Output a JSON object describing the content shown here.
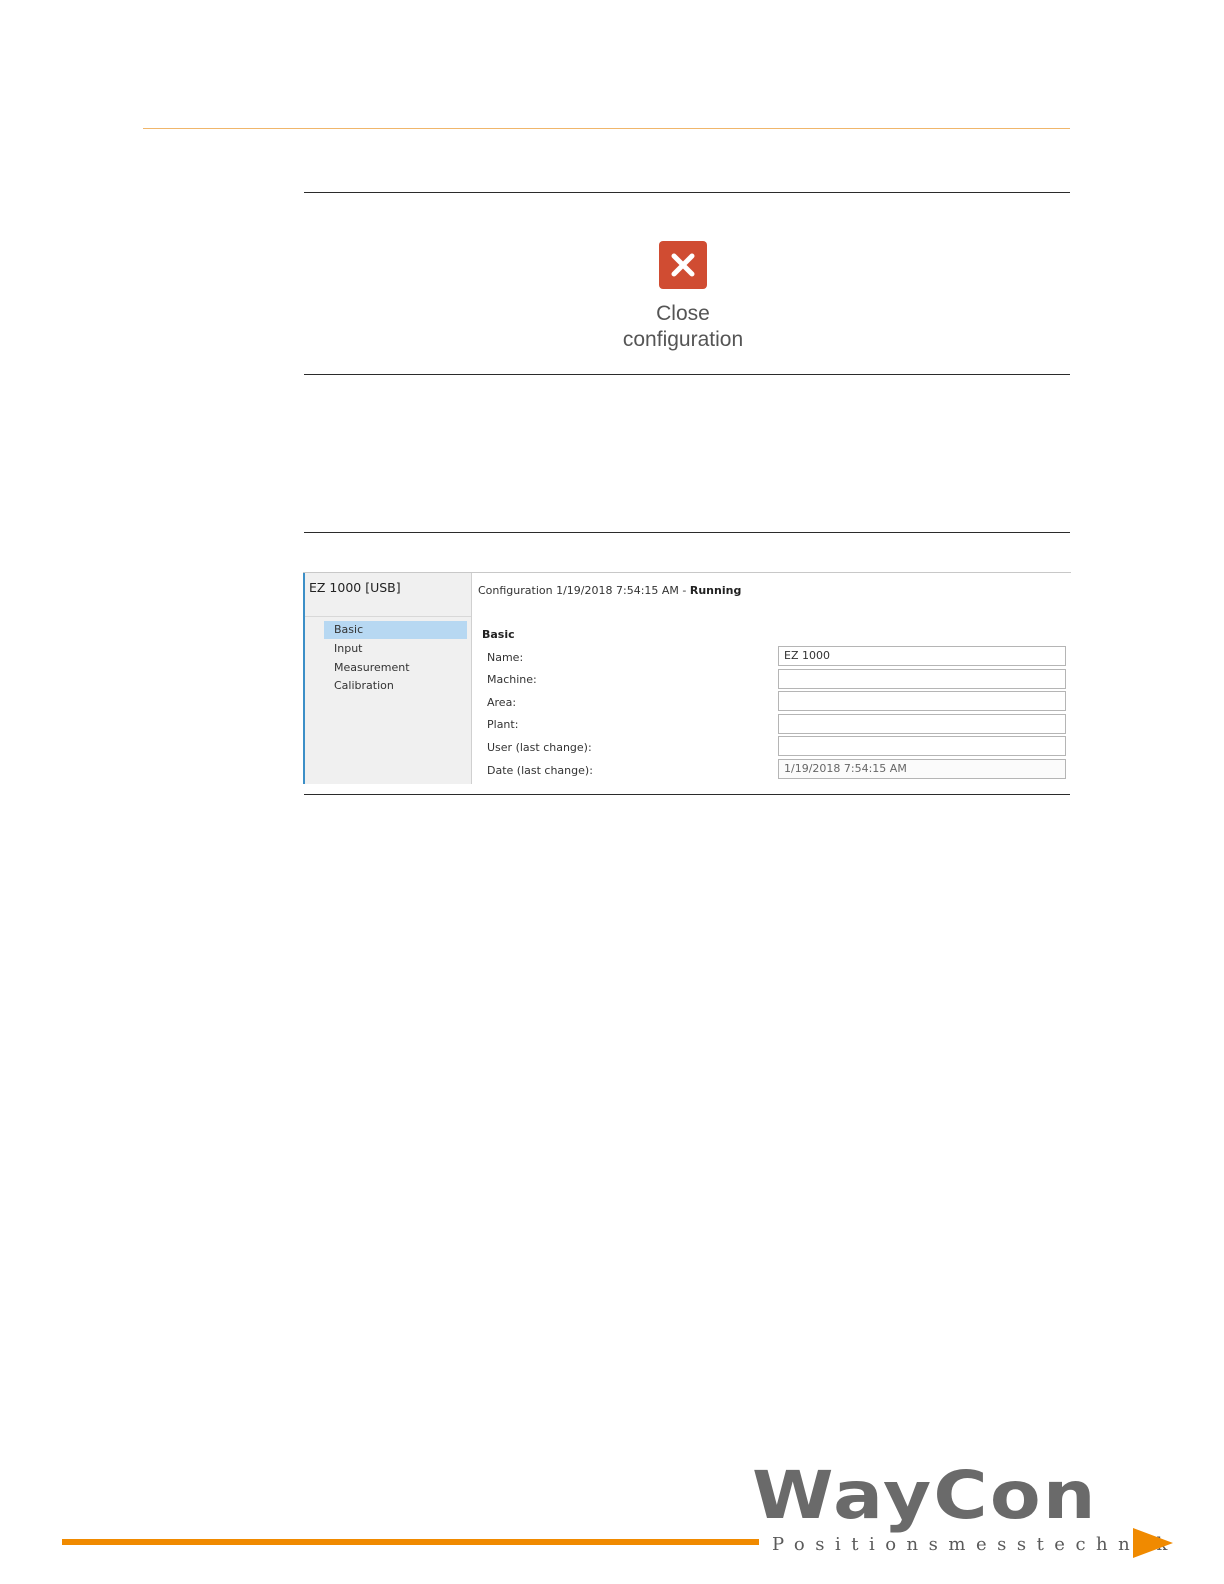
{
  "close_button": {
    "label": "Close\nconfiguration",
    "color": "#d04c32"
  },
  "panel": {
    "device_title": "EZ 1000 [USB]",
    "nav": [
      {
        "label": "Basic",
        "selected": true
      },
      {
        "label": "Input",
        "selected": false
      },
      {
        "label": "Measurement",
        "selected": false
      },
      {
        "label": "Calibration",
        "selected": false
      }
    ],
    "config_prefix": "Configuration 1/19/2018 7:54:15 AM - ",
    "config_status": "Running",
    "section_title": "Basic",
    "fields": [
      {
        "label": "Name:",
        "value": "EZ 1000"
      },
      {
        "label": "Machine:",
        "value": ""
      },
      {
        "label": "Area:",
        "value": ""
      },
      {
        "label": "Plant:",
        "value": ""
      },
      {
        "label": "User (last change):",
        "value": ""
      },
      {
        "label": "Date (last change):",
        "value": "1/19/2018 7:54:15 AM"
      }
    ]
  },
  "footer": {
    "logo_text": "WayCon",
    "tagline": "Positionsmesstechnik",
    "accent_color": "#f08a00"
  }
}
